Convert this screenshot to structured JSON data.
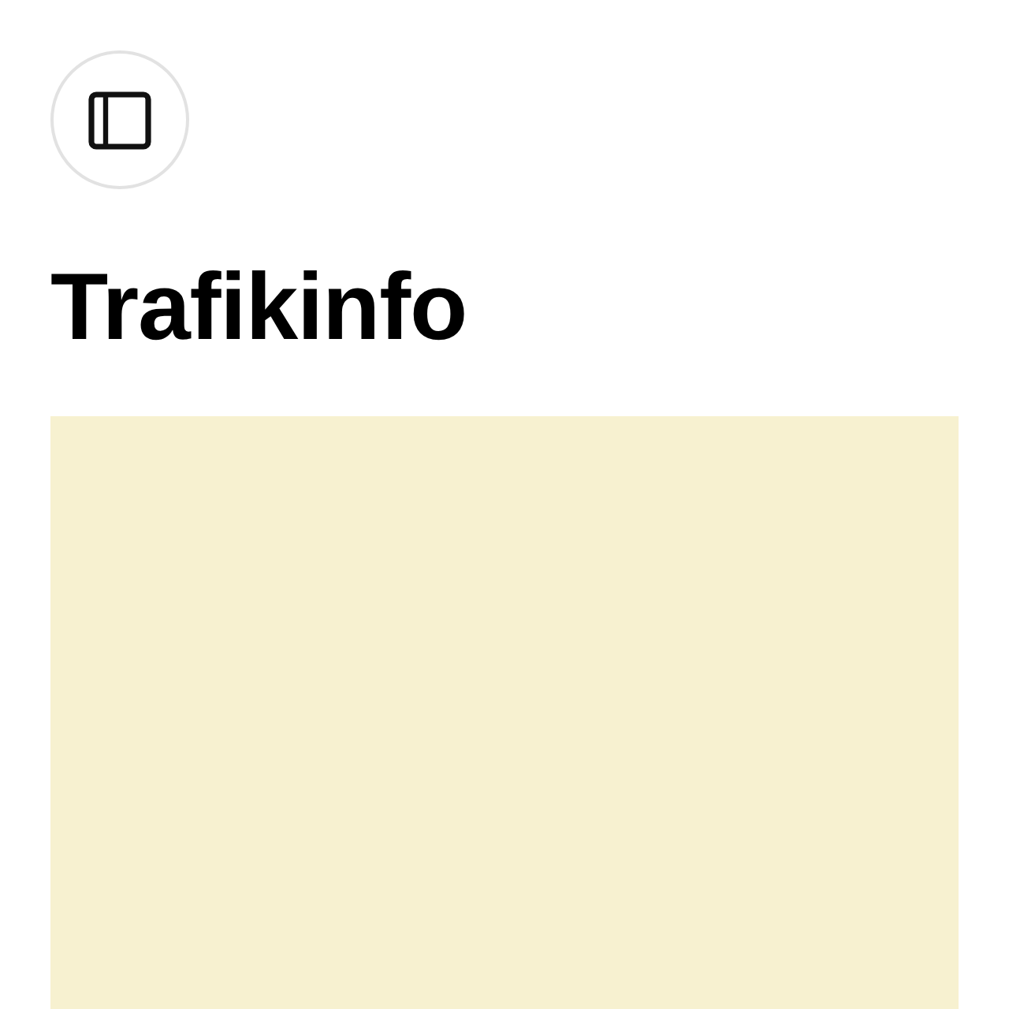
{
  "header": {
    "title": "Trafikinfo"
  }
}
